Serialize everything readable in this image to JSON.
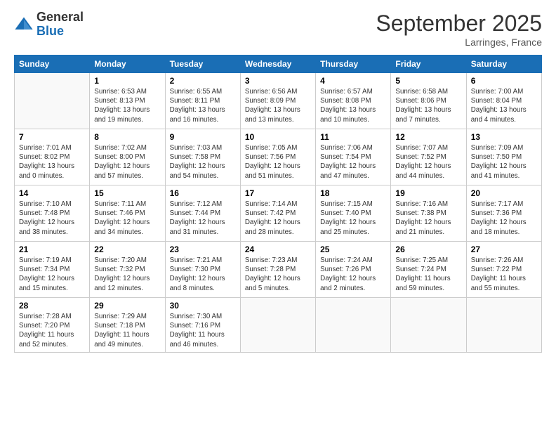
{
  "logo": {
    "general": "General",
    "blue": "Blue"
  },
  "title": "September 2025",
  "location": "Larringes, France",
  "days_header": [
    "Sunday",
    "Monday",
    "Tuesday",
    "Wednesday",
    "Thursday",
    "Friday",
    "Saturday"
  ],
  "weeks": [
    [
      {
        "day": "",
        "info": ""
      },
      {
        "day": "1",
        "info": "Sunrise: 6:53 AM\nSunset: 8:13 PM\nDaylight: 13 hours\nand 19 minutes."
      },
      {
        "day": "2",
        "info": "Sunrise: 6:55 AM\nSunset: 8:11 PM\nDaylight: 13 hours\nand 16 minutes."
      },
      {
        "day": "3",
        "info": "Sunrise: 6:56 AM\nSunset: 8:09 PM\nDaylight: 13 hours\nand 13 minutes."
      },
      {
        "day": "4",
        "info": "Sunrise: 6:57 AM\nSunset: 8:08 PM\nDaylight: 13 hours\nand 10 minutes."
      },
      {
        "day": "5",
        "info": "Sunrise: 6:58 AM\nSunset: 8:06 PM\nDaylight: 13 hours\nand 7 minutes."
      },
      {
        "day": "6",
        "info": "Sunrise: 7:00 AM\nSunset: 8:04 PM\nDaylight: 13 hours\nand 4 minutes."
      }
    ],
    [
      {
        "day": "7",
        "info": "Sunrise: 7:01 AM\nSunset: 8:02 PM\nDaylight: 13 hours\nand 0 minutes."
      },
      {
        "day": "8",
        "info": "Sunrise: 7:02 AM\nSunset: 8:00 PM\nDaylight: 12 hours\nand 57 minutes."
      },
      {
        "day": "9",
        "info": "Sunrise: 7:03 AM\nSunset: 7:58 PM\nDaylight: 12 hours\nand 54 minutes."
      },
      {
        "day": "10",
        "info": "Sunrise: 7:05 AM\nSunset: 7:56 PM\nDaylight: 12 hours\nand 51 minutes."
      },
      {
        "day": "11",
        "info": "Sunrise: 7:06 AM\nSunset: 7:54 PM\nDaylight: 12 hours\nand 47 minutes."
      },
      {
        "day": "12",
        "info": "Sunrise: 7:07 AM\nSunset: 7:52 PM\nDaylight: 12 hours\nand 44 minutes."
      },
      {
        "day": "13",
        "info": "Sunrise: 7:09 AM\nSunset: 7:50 PM\nDaylight: 12 hours\nand 41 minutes."
      }
    ],
    [
      {
        "day": "14",
        "info": "Sunrise: 7:10 AM\nSunset: 7:48 PM\nDaylight: 12 hours\nand 38 minutes."
      },
      {
        "day": "15",
        "info": "Sunrise: 7:11 AM\nSunset: 7:46 PM\nDaylight: 12 hours\nand 34 minutes."
      },
      {
        "day": "16",
        "info": "Sunrise: 7:12 AM\nSunset: 7:44 PM\nDaylight: 12 hours\nand 31 minutes."
      },
      {
        "day": "17",
        "info": "Sunrise: 7:14 AM\nSunset: 7:42 PM\nDaylight: 12 hours\nand 28 minutes."
      },
      {
        "day": "18",
        "info": "Sunrise: 7:15 AM\nSunset: 7:40 PM\nDaylight: 12 hours\nand 25 minutes."
      },
      {
        "day": "19",
        "info": "Sunrise: 7:16 AM\nSunset: 7:38 PM\nDaylight: 12 hours\nand 21 minutes."
      },
      {
        "day": "20",
        "info": "Sunrise: 7:17 AM\nSunset: 7:36 PM\nDaylight: 12 hours\nand 18 minutes."
      }
    ],
    [
      {
        "day": "21",
        "info": "Sunrise: 7:19 AM\nSunset: 7:34 PM\nDaylight: 12 hours\nand 15 minutes."
      },
      {
        "day": "22",
        "info": "Sunrise: 7:20 AM\nSunset: 7:32 PM\nDaylight: 12 hours\nand 12 minutes."
      },
      {
        "day": "23",
        "info": "Sunrise: 7:21 AM\nSunset: 7:30 PM\nDaylight: 12 hours\nand 8 minutes."
      },
      {
        "day": "24",
        "info": "Sunrise: 7:23 AM\nSunset: 7:28 PM\nDaylight: 12 hours\nand 5 minutes."
      },
      {
        "day": "25",
        "info": "Sunrise: 7:24 AM\nSunset: 7:26 PM\nDaylight: 12 hours\nand 2 minutes."
      },
      {
        "day": "26",
        "info": "Sunrise: 7:25 AM\nSunset: 7:24 PM\nDaylight: 11 hours\nand 59 minutes."
      },
      {
        "day": "27",
        "info": "Sunrise: 7:26 AM\nSunset: 7:22 PM\nDaylight: 11 hours\nand 55 minutes."
      }
    ],
    [
      {
        "day": "28",
        "info": "Sunrise: 7:28 AM\nSunset: 7:20 PM\nDaylight: 11 hours\nand 52 minutes."
      },
      {
        "day": "29",
        "info": "Sunrise: 7:29 AM\nSunset: 7:18 PM\nDaylight: 11 hours\nand 49 minutes."
      },
      {
        "day": "30",
        "info": "Sunrise: 7:30 AM\nSunset: 7:16 PM\nDaylight: 11 hours\nand 46 minutes."
      },
      {
        "day": "",
        "info": ""
      },
      {
        "day": "",
        "info": ""
      },
      {
        "day": "",
        "info": ""
      },
      {
        "day": "",
        "info": ""
      }
    ]
  ]
}
